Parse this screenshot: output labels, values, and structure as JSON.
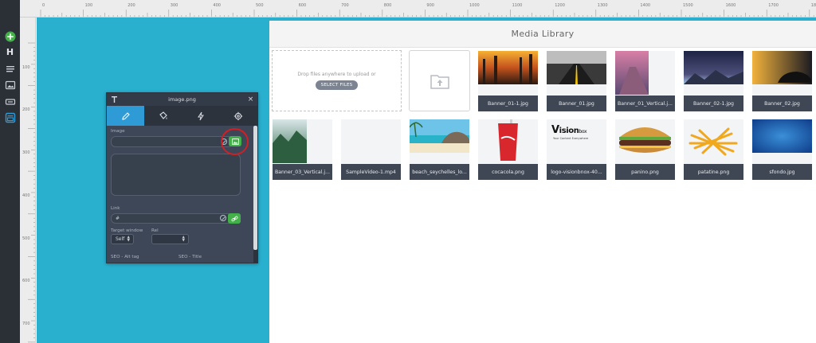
{
  "ruler": {
    "top_labels": [
      "0",
      "100",
      "200",
      "300",
      "400",
      "500",
      "600",
      "700",
      "800",
      "900",
      "1000",
      "1100",
      "1200",
      "1300",
      "1400",
      "1500",
      "1600",
      "1700",
      "1800"
    ],
    "left_labels": [
      "100",
      "200",
      "300",
      "400",
      "500",
      "600",
      "700"
    ]
  },
  "toolbar": {
    "items": [
      "add-icon",
      "heading-icon",
      "text-lines-icon",
      "image-icon",
      "button-icon",
      "media-icon"
    ],
    "heading_glyph": "H",
    "accent": "#43b04a"
  },
  "canvas": {
    "color": "#2ab0cf"
  },
  "media_library": {
    "title": "Media Library",
    "dropzone_text": "Drop files anywhere to upload or",
    "select_files_label": "SELECT FILES",
    "files": [
      {
        "name": "Banner_01-1.jpg"
      },
      {
        "name": "Banner_01.jpg"
      },
      {
        "name": "Banner_01_Vertical.j..."
      },
      {
        "name": "Banner_02-1.jpg"
      },
      {
        "name": "Banner_02.jpg"
      },
      {
        "name": "Banner_03_Vertical.j..."
      },
      {
        "name": "SampleVideo-1.mp4"
      },
      {
        "name": "beach_seychelles_lo..."
      },
      {
        "name": "cocacola.png"
      },
      {
        "name": "logo-visionbnox-40..."
      },
      {
        "name": "panino.png"
      },
      {
        "name": "patatine.png"
      },
      {
        "name": "sfondo.jpg"
      }
    ],
    "logo_text_a": "ision",
    "logo_text_b": "box",
    "logo_tagline": "Your Content Everywhere"
  },
  "panel": {
    "title": "image.png",
    "close_glyph": "×",
    "tabs": [
      "pencil-icon",
      "paint-icon",
      "lightning-icon",
      "gear-icon"
    ],
    "image_label": "Image",
    "link_label": "Link",
    "link_value": "#",
    "target_window_label": "Target window",
    "target_window_value": "Self",
    "rel_label": "Rel",
    "rel_value": "",
    "seo_alt_label": "SEO - Alt tag",
    "seo_title_label": "SEO - Title",
    "active_tab_color": "#2e9bd6"
  }
}
